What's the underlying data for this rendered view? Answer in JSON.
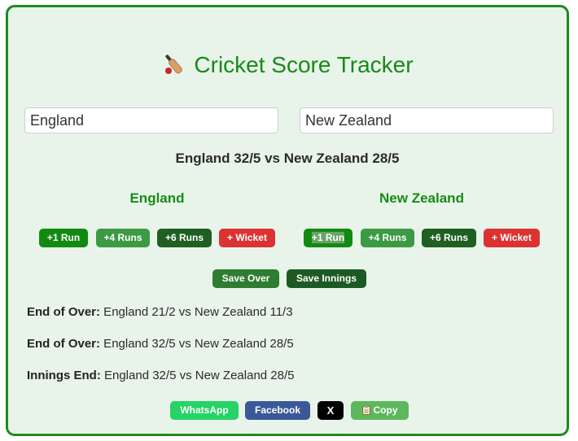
{
  "title": "Cricket Score Tracker",
  "title_icon": "cricket-bat-icon",
  "team_a": {
    "input_value": "England",
    "name": "England",
    "buttons": {
      "run1": "+1 Run",
      "run4": "+4 Runs",
      "run6": "+6 Runs",
      "wicket": "+ Wicket"
    }
  },
  "team_b": {
    "input_value": "New Zealand",
    "name": "New Zealand",
    "buttons": {
      "run1": "+1 Run",
      "run4": "+4 Runs",
      "run6": "+6 Runs",
      "wicket": "+ Wicket"
    }
  },
  "score_summary": "England 32/5 vs New Zealand 28/5",
  "actions": {
    "save_over": "Save Over",
    "save_innings": "Save Innings"
  },
  "log": [
    {
      "label": "End of Over:",
      "text": " England 21/2 vs New Zealand 11/3"
    },
    {
      "label": "End of Over:",
      "text": " England 32/5 vs New Zealand 28/5"
    },
    {
      "label": "Innings End:",
      "text": " England 32/5 vs New Zealand 28/5"
    }
  ],
  "share": {
    "whatsapp": "WhatsApp",
    "facebook": "Facebook",
    "x": "X",
    "copy": "Copy",
    "copy_icon": "clipboard-icon"
  },
  "colors": {
    "accent_green": "#178a17",
    "wicket_red": "#dc3232",
    "card_bg": "#e8f4ea",
    "border": "#1f8a1f"
  }
}
